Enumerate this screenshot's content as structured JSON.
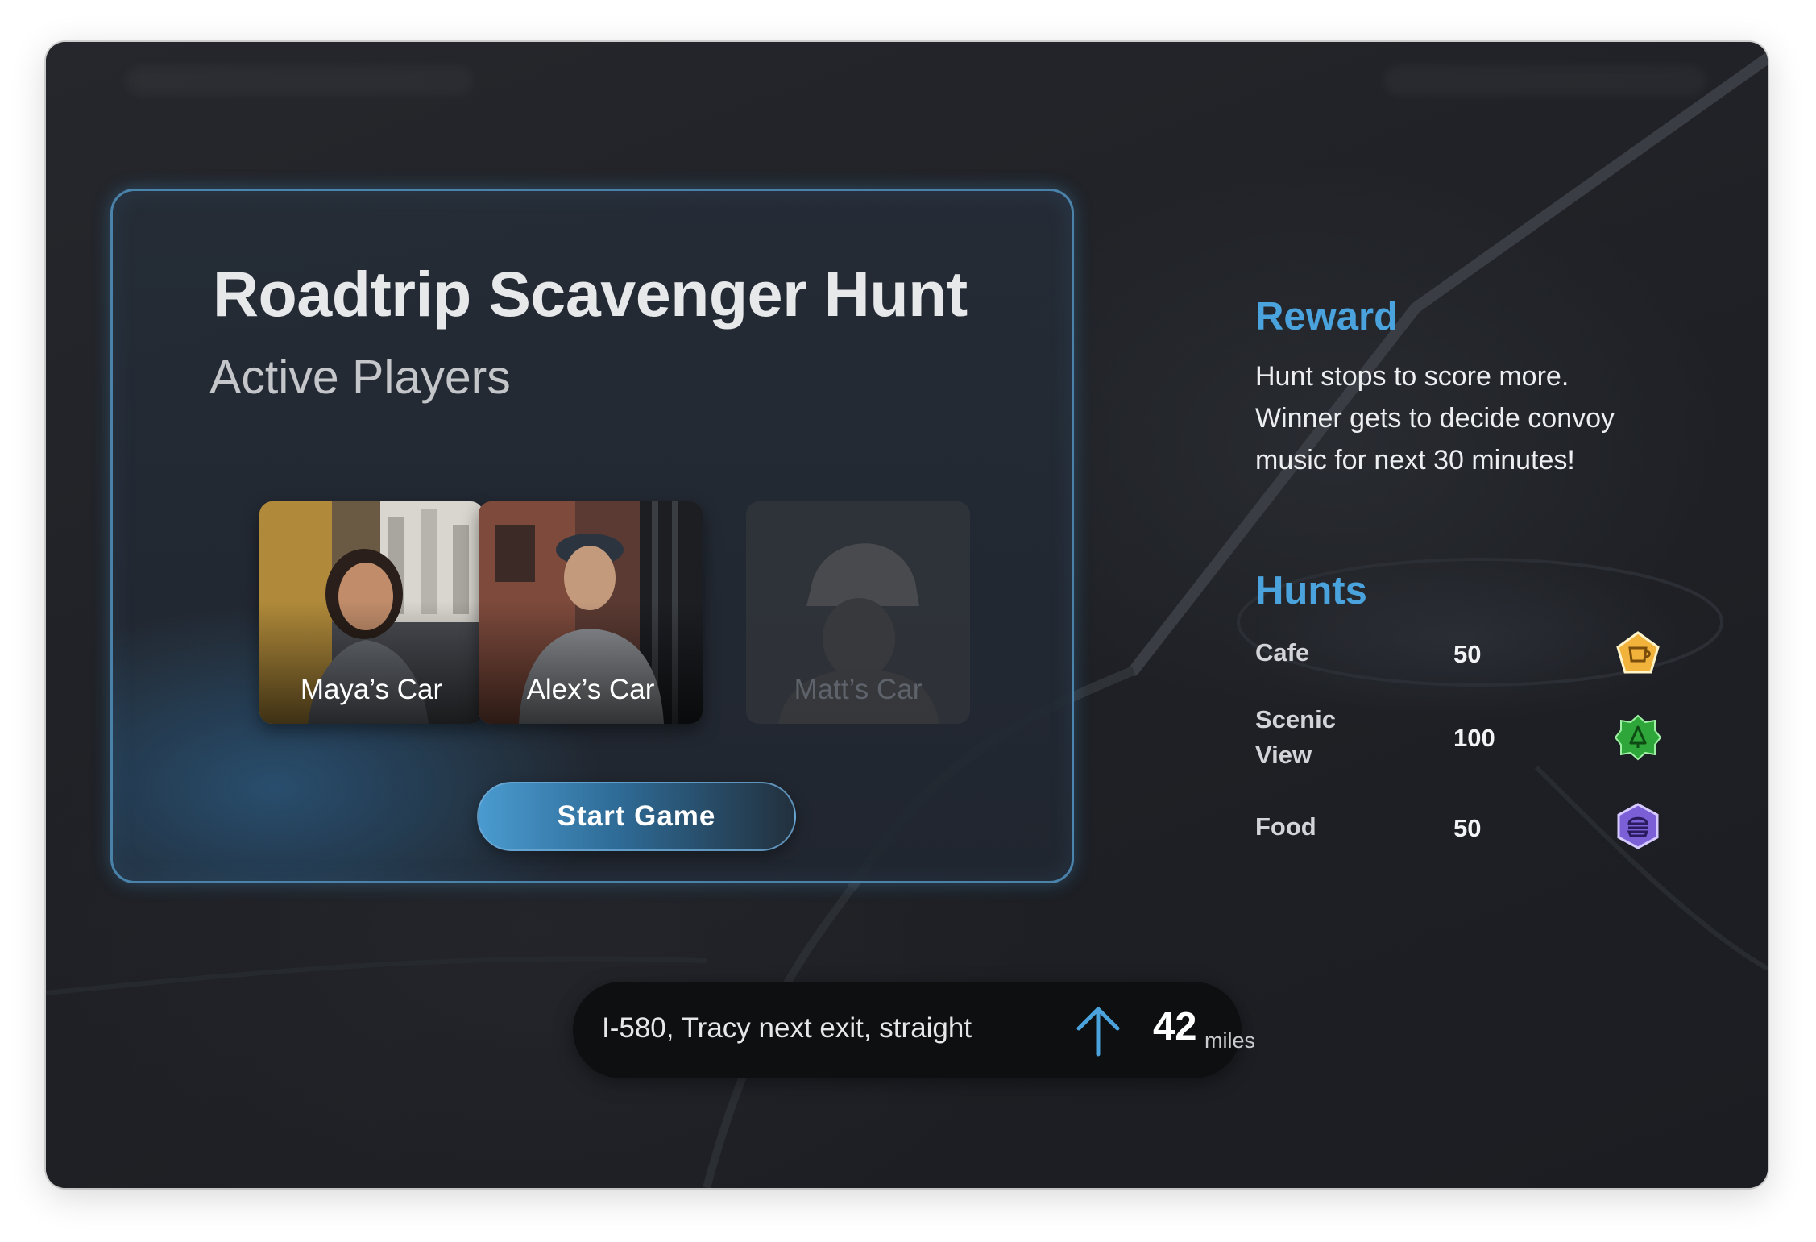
{
  "game": {
    "title": "Roadtrip Scavenger Hunt",
    "subtitle": "Active Players",
    "players": [
      {
        "label": "Maya’s Car",
        "active": true
      },
      {
        "label": "Alex’s Car",
        "active": true
      },
      {
        "label": "Matt’s Car",
        "active": false
      }
    ],
    "start_label": "Start Game"
  },
  "reward": {
    "heading": "Reward",
    "lines": [
      "Hunt stops to score more.",
      "Winner gets to decide convoy",
      "music for next 30 minutes!"
    ]
  },
  "hunts": {
    "heading": "Hunts",
    "items": [
      {
        "name_lines": [
          "Cafe"
        ],
        "points": "50",
        "icon": "cafe-badge-icon",
        "color": "#f2b33d"
      },
      {
        "name_lines": [
          "Scenic",
          "View"
        ],
        "points": "100",
        "icon": "tree-badge-icon",
        "color": "#2fa63a"
      },
      {
        "name_lines": [
          "Food"
        ],
        "points": "50",
        "icon": "burger-badge-icon",
        "color": "#7a5fd6"
      }
    ]
  },
  "navigation": {
    "instruction": "I-580, Tracy next exit, straight",
    "direction_icon": "arrow-up-icon",
    "distance": "42",
    "unit": "miles"
  },
  "colors": {
    "accent": "#4aa3dc",
    "background": "#1d1f24",
    "card_border": "#58a0d2"
  }
}
